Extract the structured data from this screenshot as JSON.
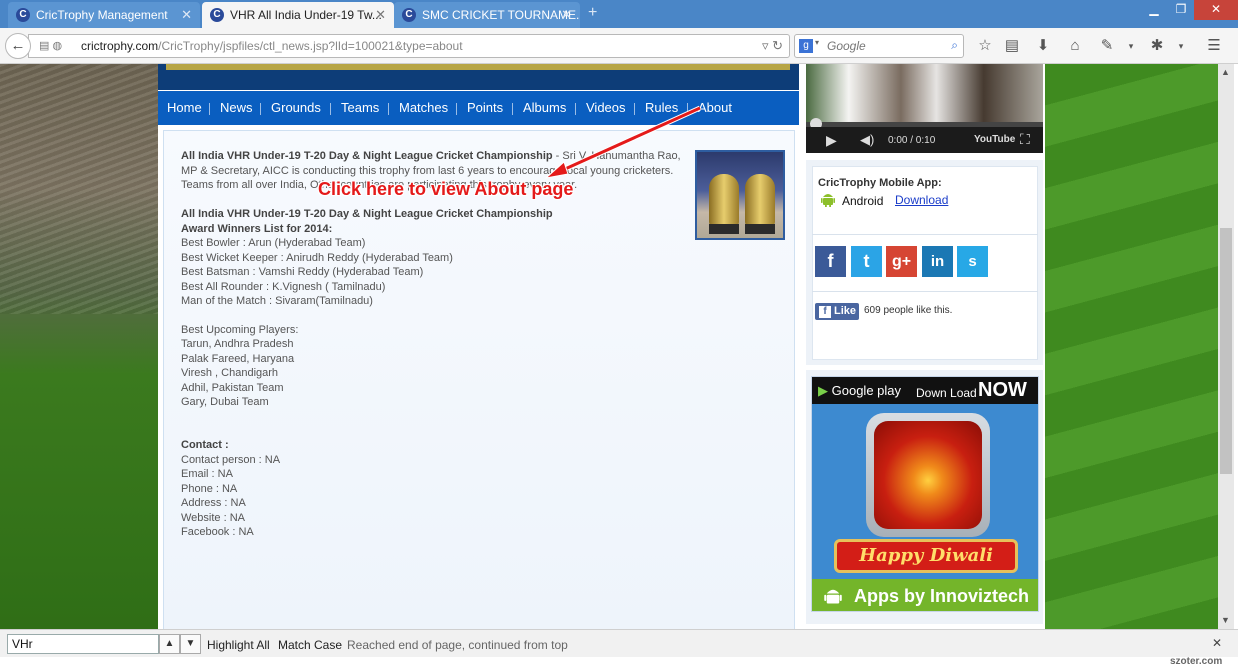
{
  "browser": {
    "tabs": [
      {
        "label": "CricTrophy Management"
      },
      {
        "label": "VHR All India Under-19 Tw..."
      },
      {
        "label": "SMC CRICKET TOURNAME..."
      }
    ],
    "new_tab": "+",
    "url_host": "crictrophy.com",
    "url_path": "/CricTrophy/jspfiles/ctl_news.jsp?lId=100021&type=about",
    "search_placeholder": "Google",
    "search_engine": "g"
  },
  "site": {
    "nav": [
      "Home",
      "News",
      "Grounds",
      "Teams",
      "Matches",
      "Points",
      "Albums",
      "Videos",
      "Rules",
      "About"
    ],
    "intro_bold": "All India VHR Under-19 T-20 Day & Night League Cricket Championship",
    "intro_text": " - Sri V. Hanumantha Rao, MP & Secretary, AICC is conducting this trophy from last 6 years to encourage local young cricketers. Teams from all over India, Other countries are participating this trophy every year.",
    "award_title": "All India VHR Under-19 T-20 Day & Night League Cricket Championship",
    "award_subtitle": "Award Winners List for 2014:",
    "awards": [
      "Best Bowler : Arun (Hyderabad Team)",
      "Best Wicket Keeper : Anirudh Reddy (Hyderabad Team)",
      "Best Batsman : Vamshi Reddy (Hyderabad Team)",
      "Best All Rounder : K.Vignesh ( Tamilnadu)",
      "Man of the Match : Sivaram(Tamilnadu)"
    ],
    "upcoming_title": "Best Upcoming Players:",
    "upcoming": [
      "Tarun, Andhra Pradesh",
      "Palak Fareed, Haryana",
      "Viresh , Chandigarh",
      "Adhil, Pakistan Team",
      "Gary, Dubai Team"
    ],
    "contact_title": "Contact :",
    "contact": [
      "Contact person : NA",
      "Email : NA",
      "Phone : NA",
      "Address : NA",
      "Website : NA",
      "Facebook : NA"
    ],
    "callout": "Click here to view About page",
    "video_time": "0:00 / 0:10",
    "video_brand": "YouTube",
    "app_title": "CricTrophy Mobile App:",
    "android_label": "Android",
    "download_label": "Download",
    "social": [
      "f",
      "t",
      "g+",
      "in",
      "s"
    ],
    "like_label": "Like",
    "like_count": "609 people like this.",
    "ad_googleplay": "Google play",
    "ad_download": "Down Load",
    "ad_now": "NOW",
    "ad_diwali": "Happy Diwali",
    "ad_bottom": "Apps by Innoviztech"
  },
  "findbar": {
    "query": "VHr",
    "highlight_all": "Highlight All",
    "match_case": "Match Case",
    "status": "Reached end of page, continued from top"
  },
  "watermark": "szoter.com"
}
